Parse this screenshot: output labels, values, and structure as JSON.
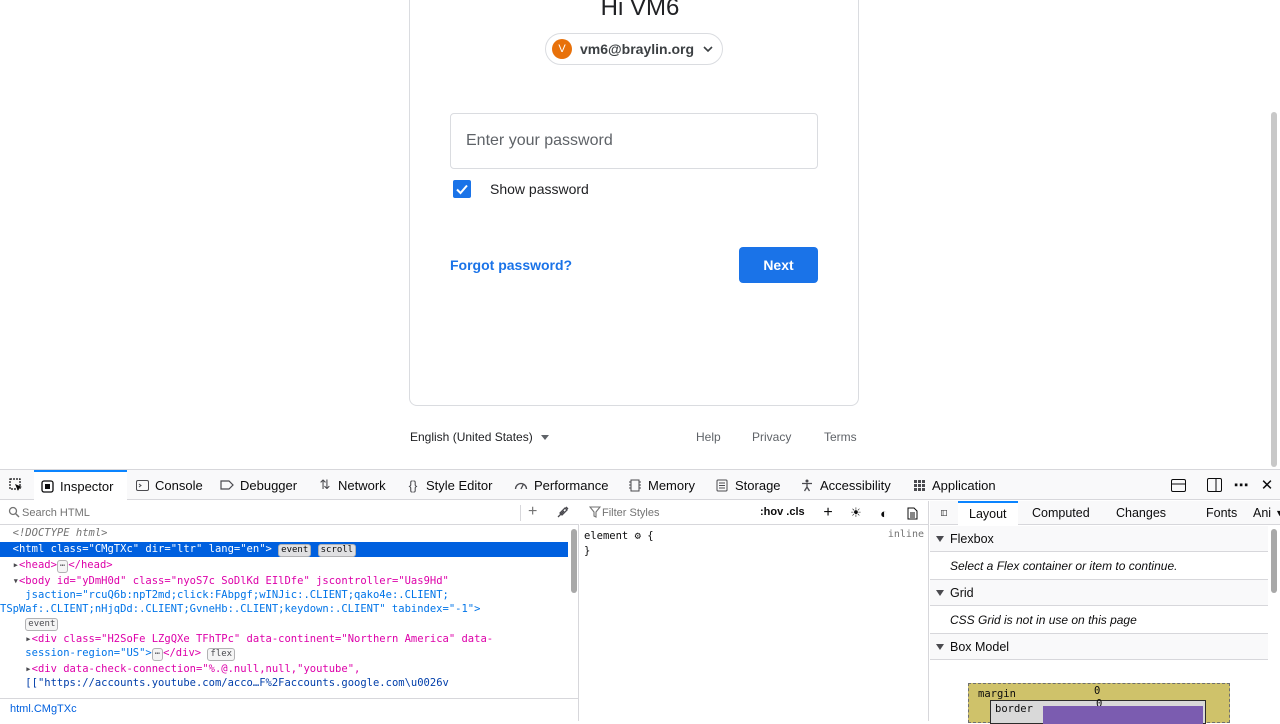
{
  "page": {
    "greeting": "Hi VM6",
    "account": {
      "avatar_letter": "V",
      "email": "vm6@braylin.org"
    },
    "password": {
      "placeholder": "Enter your password",
      "value": ""
    },
    "show_password": {
      "label": "Show password",
      "checked": true
    },
    "forgot_link": "Forgot password?",
    "next_button": "Next",
    "footer": {
      "language": "English (United States)",
      "links": [
        "Help",
        "Privacy",
        "Terms"
      ]
    },
    "colors": {
      "primary": "#1a73e8",
      "avatar": "#e8710a"
    }
  },
  "devtools": {
    "tabs": [
      {
        "label": "Inspector",
        "icon": "inspector-icon"
      },
      {
        "label": "Console",
        "icon": "console-icon"
      },
      {
        "label": "Debugger",
        "icon": "debugger-icon"
      },
      {
        "label": "Network",
        "icon": "network-icon"
      },
      {
        "label": "Style Editor",
        "icon": "style-editor-icon"
      },
      {
        "label": "Performance",
        "icon": "performance-icon"
      },
      {
        "label": "Memory",
        "icon": "memory-icon"
      },
      {
        "label": "Storage",
        "icon": "storage-icon"
      },
      {
        "label": "Accessibility",
        "icon": "accessibility-icon"
      },
      {
        "label": "Application",
        "icon": "application-icon"
      }
    ],
    "markup": {
      "search_placeholder": "Search HTML",
      "lines": {
        "doctype": "<!DOCTYPE html>",
        "html_open": "<html class=\"CMgTXc\" dir=\"ltr\" lang=\"en\">",
        "head": "<head>",
        "head_close": "</head>",
        "body1": "<body id=\"yDmH0d\" class=\"nyoS7c SoDlKd EIlDfe\" jscontroller=\"Uas9Hd\"",
        "body2": "jsaction=\"rcuQ6b:npT2md;click:FAbpgf;wINJic:.CLIENT;qako4e:.CLIENT;",
        "body3": "TSpWaf:.CLIENT;nHjqDd:.CLIENT;GvneHb:.CLIENT;keydown:.CLIENT\" tabindex=\"-1\">",
        "div1a": "<div class=\"H2SoFe LZgQXe TFhTPc\" data-continent=\"Northern America\" data-",
        "div1b": "session-region=\"US\">",
        "div1c": "</div>",
        "div2a": "<div data-check-connection=\"%.@.null,null,\"youtube\",",
        "div2b": "[[\"https://accounts.youtube.com/acco…F%2Faccounts.google.com\\u0026v"
      },
      "badges": {
        "event": "event",
        "scroll": "scroll",
        "flex": "flex",
        "ellipsis": "⋯"
      },
      "breadcrumb": "html.CMgTXc"
    },
    "rules": {
      "filter_placeholder": "Filter Styles",
      "pseudo": ":hov .cls",
      "element_rule": "element",
      "open_brace": "{",
      "close_brace": "}",
      "inline": "inline"
    },
    "layout": {
      "tabs": [
        "Layout",
        "Computed",
        "Changes",
        "Fonts",
        "Ani"
      ],
      "flexbox_title": "Flexbox",
      "flexbox_msg": "Select a Flex container or item to continue.",
      "grid_title": "Grid",
      "grid_msg": "CSS Grid is not in use on this page",
      "boxmodel_title": "Box Model",
      "margin_label": "margin",
      "margin_value": "0",
      "border_label": "border",
      "border_value": "0"
    }
  }
}
